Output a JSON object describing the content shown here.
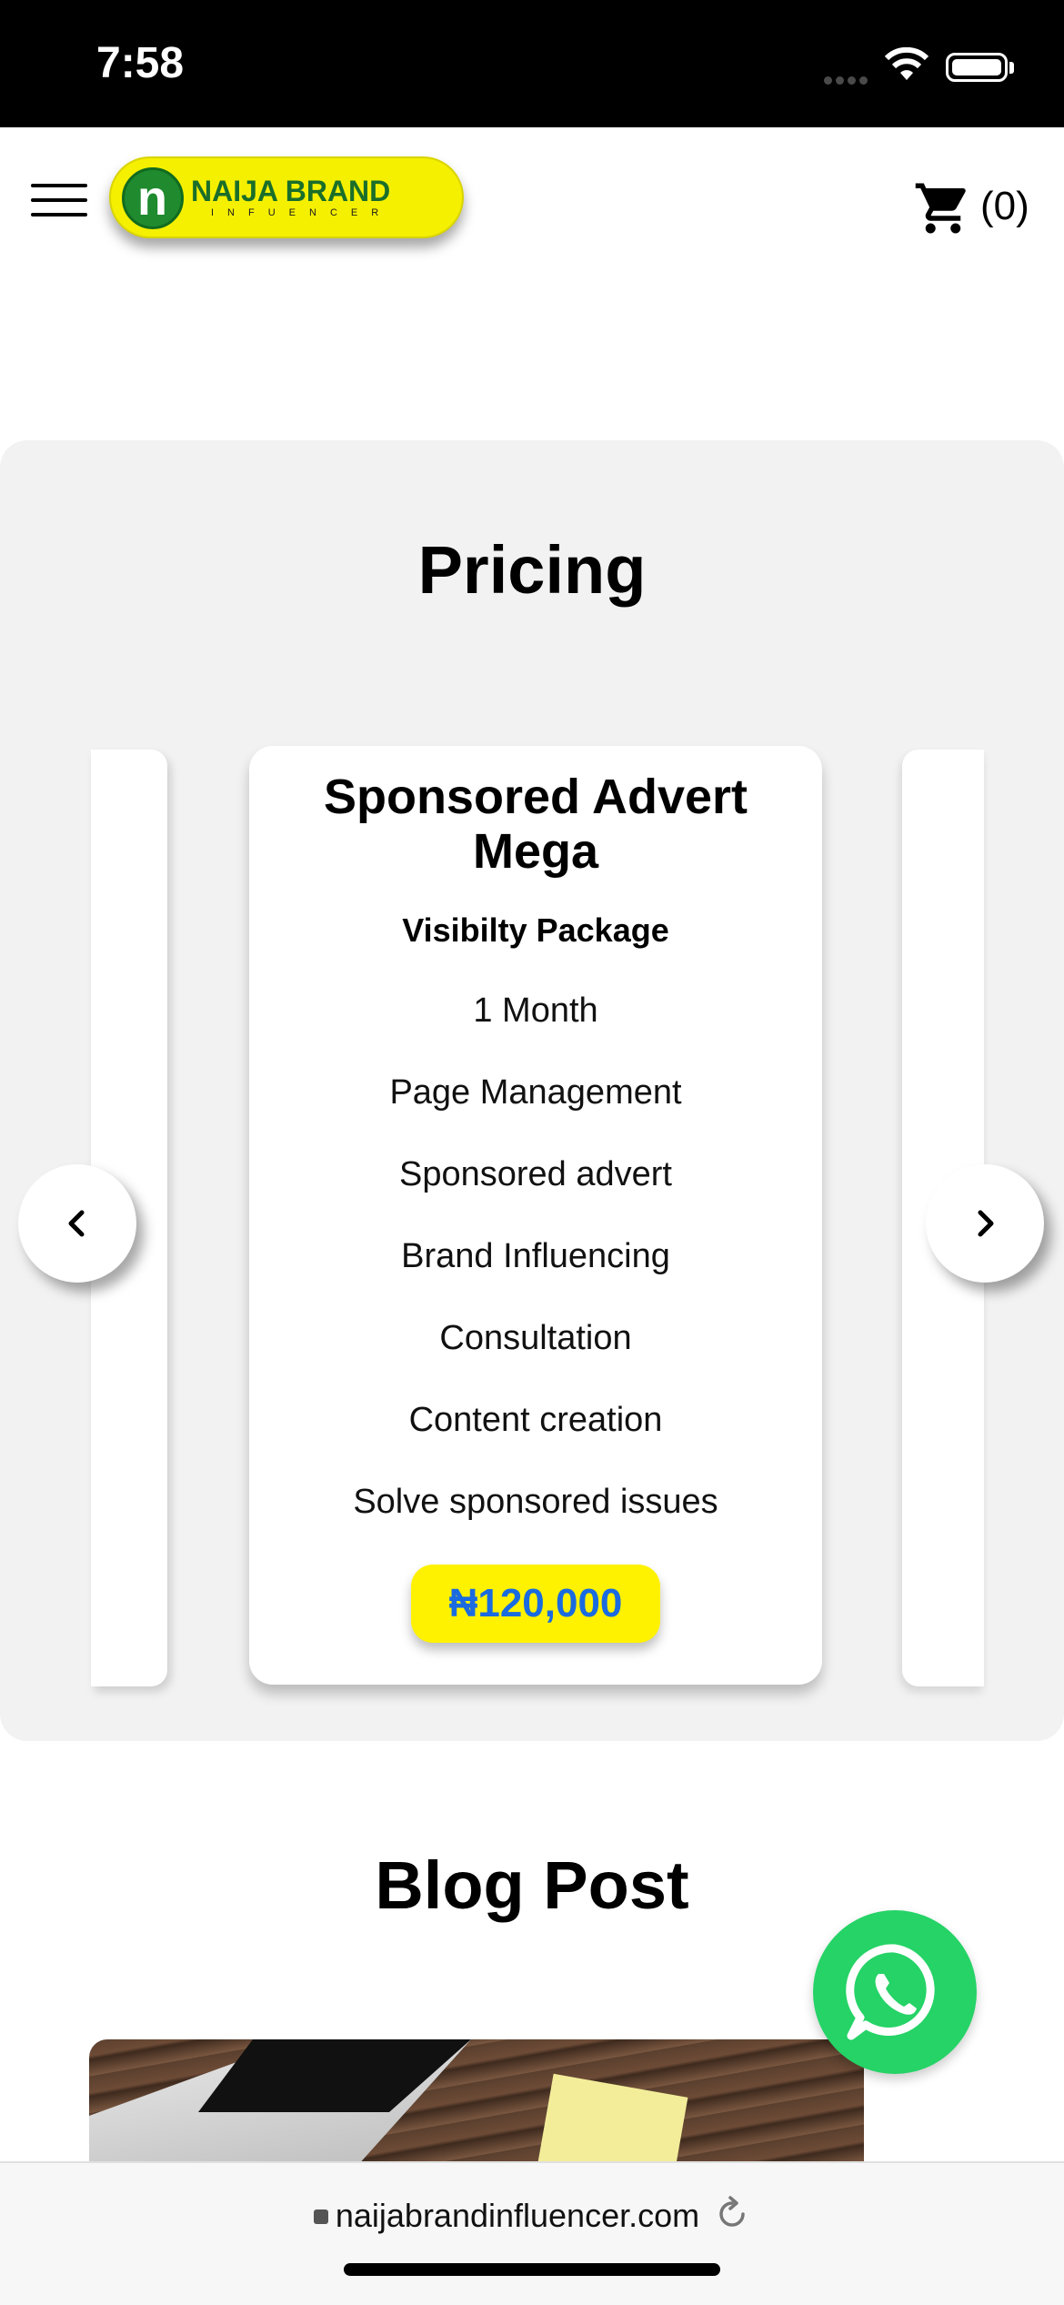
{
  "status_bar": {
    "time": "7:58"
  },
  "header": {
    "logo_title": "NAIJA BRAND",
    "logo_subtitle": "INFUENCER",
    "cart_count": "(0)"
  },
  "pricing": {
    "title": "Pricing",
    "card": {
      "title_line1": "Sponsored Advert",
      "title_line2": "Mega",
      "subtitle": "Visibilty Package",
      "features": [
        "1 Month",
        "Page Management",
        "Sponsored advert",
        "Brand Influencing",
        "Consultation",
        "Content creation",
        "Solve sponsored issues"
      ],
      "price": "₦120,000"
    },
    "icons": {
      "prev": "chevron-left-icon",
      "next": "chevron-right-icon"
    }
  },
  "blog": {
    "title": "Blog Post"
  },
  "browser": {
    "url": "naijabrandinfluencer.com"
  },
  "colors": {
    "accent_yellow": "#fff200",
    "price_blue": "#1a6be0",
    "whatsapp_green": "#25d366"
  }
}
